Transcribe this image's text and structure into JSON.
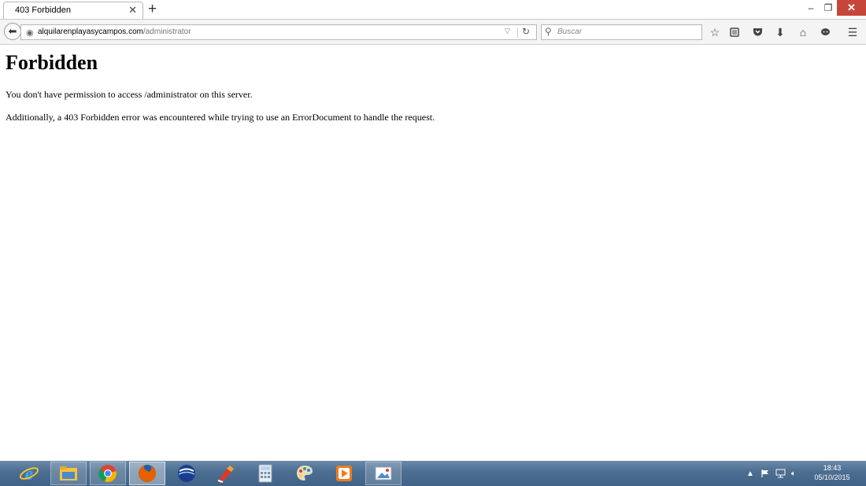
{
  "browser": {
    "tab_title": "403 Forbidden",
    "url_domain": "alquilarenplayasycampos.com",
    "url_path": "/administrator",
    "search_placeholder": "Buscar"
  },
  "page": {
    "heading": "Forbidden",
    "paragraph1": "You don't have permission to access /administrator on this server.",
    "paragraph2": "Additionally, a 403 Forbidden error was encountered while trying to use an ErrorDocument to handle the request."
  },
  "taskbar": {
    "apps": [
      "internet-explorer",
      "file-explorer",
      "chrome",
      "firefox",
      "google-earth",
      "ccleaner",
      "calculator",
      "paint",
      "media-player",
      "image-viewer"
    ],
    "clock_time": "18:43",
    "clock_date": "05/10/2015"
  },
  "colors": {
    "close_button": "#c7463a",
    "taskbar": "#4d6f92"
  }
}
